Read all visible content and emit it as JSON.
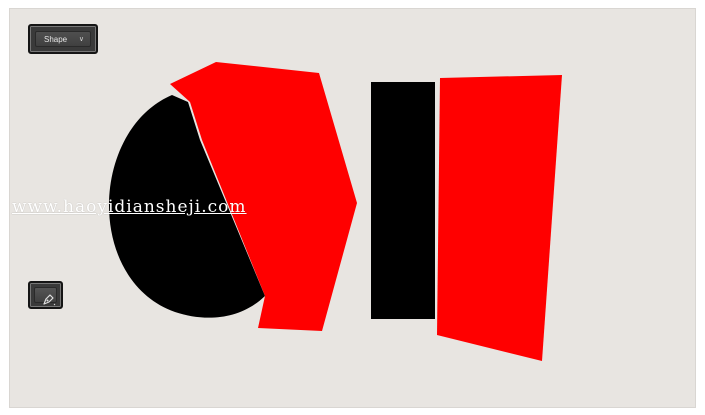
{
  "toolbar": {
    "shape_dropdown": {
      "label": "Shape",
      "icon": "chevron-down-icon"
    },
    "pen_tool": {
      "icon": "pen-tool-icon"
    }
  },
  "watermark": {
    "text": "www.haoyidiansheji.com"
  },
  "colors": {
    "canvas_background": "#e8e5e1",
    "shape_red": "#ff0000",
    "shape_black": "#000000",
    "panel_dark": "#3a3a3a"
  }
}
